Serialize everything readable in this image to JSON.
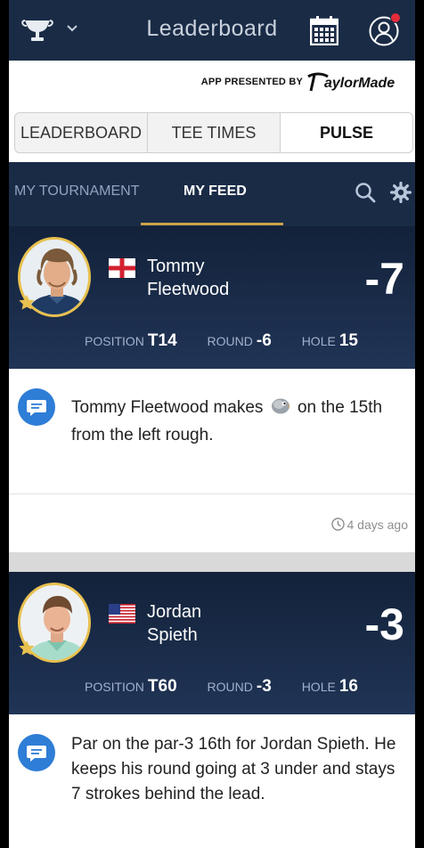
{
  "nav": {
    "title": "Leaderboard",
    "left_icon": "trophy-icon",
    "calendar_icon": "calendar-icon",
    "profile_icon": "user-icon"
  },
  "sponsor": {
    "text": "APP PRESENTED BY",
    "logo": "TaylorMade"
  },
  "tabs": [
    {
      "label": "LEADERBOARD",
      "selected": false
    },
    {
      "label": "TEE TIMES",
      "selected": false
    },
    {
      "label": "PULSE",
      "selected": true
    }
  ],
  "feed_tabs": {
    "tournament": "MY TOURNAMENT",
    "feed": "MY FEED",
    "active": "MY FEED"
  },
  "cards": [
    {
      "first": "Tommy",
      "last": "Fleetwood",
      "country_flag": "england-flag-icon",
      "score": "-7",
      "position_label": "POSITION",
      "position": "T14",
      "round_label": "ROUND",
      "round": "-6",
      "hole_label": "HOLE",
      "hole": "15",
      "message_before": "Tommy Fleetwood makes",
      "message_icon": "eagle-icon",
      "message_after": "on the 15th from the left rough.",
      "time": "4 days ago"
    },
    {
      "first": "Jordan",
      "last": "Spieth",
      "country_flag": "usa-flag-icon",
      "score": "-3",
      "position_label": "POSITION",
      "position": "T60",
      "round_label": "ROUND",
      "round": "-3",
      "hole_label": "HOLE",
      "hole": "16",
      "message": "Par on the par-3 16th for Jordan Spieth. He keeps his round going at 3 under and stays 7 strokes behind the lead."
    }
  ],
  "colors": {
    "navy": "#1a2b46",
    "accent_gold": "#c9a449",
    "message_blue": "#2e7dd6",
    "notification_red": "#e52c3a"
  }
}
